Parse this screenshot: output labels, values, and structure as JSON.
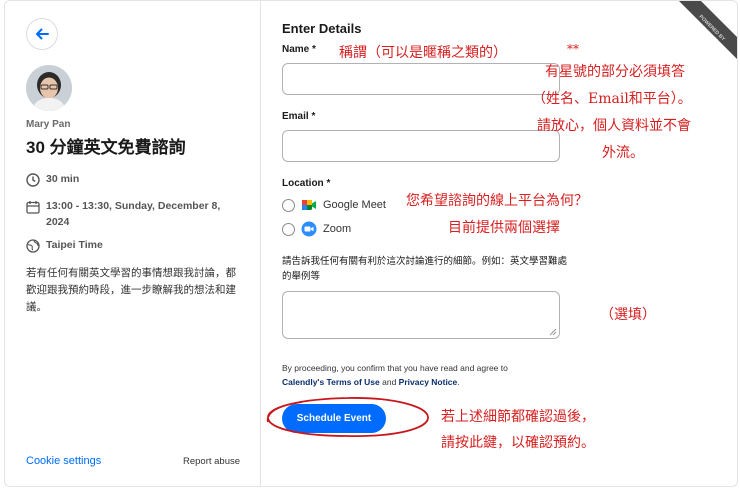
{
  "host": {
    "name": "Mary Pan"
  },
  "event": {
    "title": "30 分鐘英文免費諮詢",
    "duration": "30 min",
    "datetime": "13:00 - 13:30, Sunday, December 8, 2024",
    "timezone": "Taipei Time",
    "description": "若有任何有關英文學習的事情想跟我討論，都歡迎跟我預約時段，進一步瞭解我的想法和建議。"
  },
  "footer": {
    "cookie_settings": "Cookie settings",
    "report_abuse": "Report abuse"
  },
  "form": {
    "heading": "Enter Details",
    "name_label": "Name *",
    "email_label": "Email *",
    "location_label": "Location *",
    "location_options": [
      "Google Meet",
      "Zoom"
    ],
    "notes_label": "請告訴我任何有關有利於這次討論進行的細節。例如：英文學習難處的舉例等",
    "consent_prefix": "By proceeding, you confirm that you have read and agree to",
    "terms_link": "Calendly's Terms of Use",
    "consent_and": " and ",
    "privacy_link": "Privacy Notice",
    "consent_end": ".",
    "submit": "Schedule Event"
  },
  "badge": {
    "line1": "POWERED BY",
    "line2": "Calendly"
  },
  "annotations": {
    "name_hint": "稱謂（可以是暱稱之類的）",
    "stars": "**",
    "required_1": "有星號的部分必須填答",
    "required_2": "（姓名、Email和平台）。",
    "required_3": "請放心，個人資料並不會",
    "required_4": "外流。",
    "platform_1": "您希望諮詢的線上平台為何？",
    "platform_2": "目前提供兩個選擇",
    "optional": "（選填）",
    "confirm_1": "若上述細節都確認過後，",
    "confirm_2": "請按此鍵，以確認預約。"
  },
  "colors": {
    "accent": "#006bff",
    "annotation": "#d71f1f"
  }
}
